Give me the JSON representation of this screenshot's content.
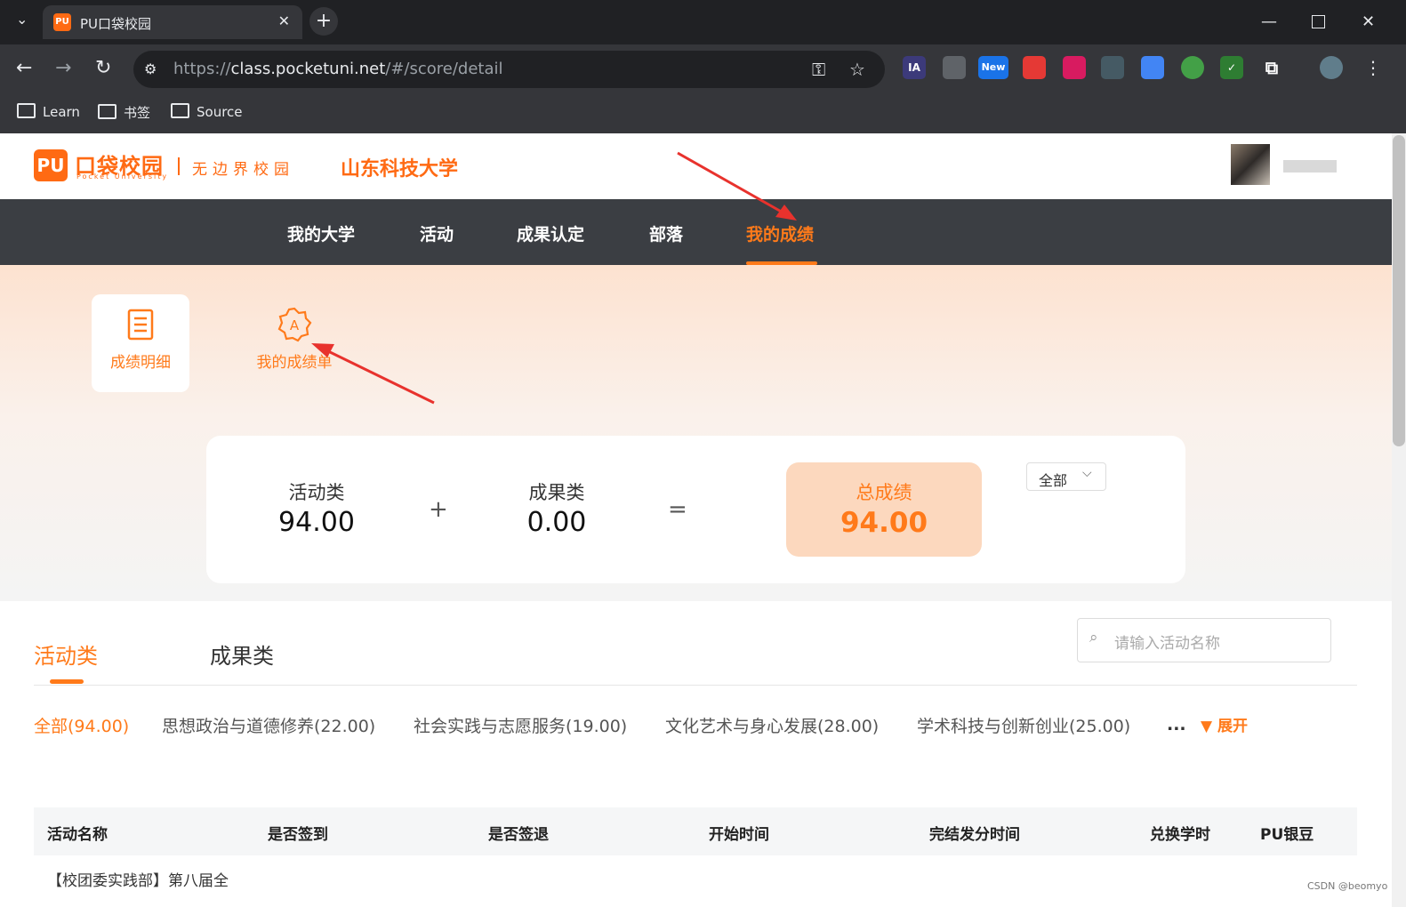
{
  "browser": {
    "tab_title": "PU口袋校园",
    "tab_favicon_text": "PU",
    "url_scheme": "https://",
    "url_host": "class.pocketuni.net",
    "url_path": "/#/score/detail",
    "bookmarks": [
      "Learn",
      "书签",
      "Source"
    ],
    "extensions": [
      "IA",
      "New"
    ]
  },
  "header": {
    "logo_mark": "PU",
    "logo_name": "口袋校园",
    "logo_sub": "Pocket University",
    "slogan": "无边界校园",
    "school": "山东科技大学"
  },
  "nav": {
    "items": [
      "我的大学",
      "活动",
      "成果认定",
      "部落",
      "我的成绩"
    ],
    "active": "我的成绩"
  },
  "hero": {
    "tabs": [
      "成绩明细",
      "我的成绩单"
    ],
    "score": {
      "activity_label": "活动类",
      "activity_value": "94.00",
      "plus": "+",
      "result_label": "成果类",
      "result_value": "0.00",
      "equals": "=",
      "total_label": "总成绩",
      "total_value": "94.00",
      "filter": "全部"
    }
  },
  "list": {
    "tabs": [
      "活动类",
      "成果类"
    ],
    "search_placeholder": "请输入活动名称",
    "categories": [
      "全部(94.00)",
      "思想政治与道德修养(22.00)",
      "社会实践与志愿服务(19.00)",
      "文化艺术与身心发展(28.00)",
      "学术科技与创新创业(25.00)"
    ],
    "more": "...",
    "expand": "展开",
    "columns": [
      "活动名称",
      "是否签到",
      "是否签退",
      "开始时间",
      "完结发分时间",
      "兑换学时",
      "PU银豆"
    ],
    "first_row_name": "【校团委实践部】第八届全"
  },
  "watermark": "CSDN @beomyo",
  "colors": {
    "accent": "#ff7a1a",
    "nav_bg": "#3b3e43",
    "total_bg": "#fcd8be",
    "annotation": "#e8322d"
  }
}
